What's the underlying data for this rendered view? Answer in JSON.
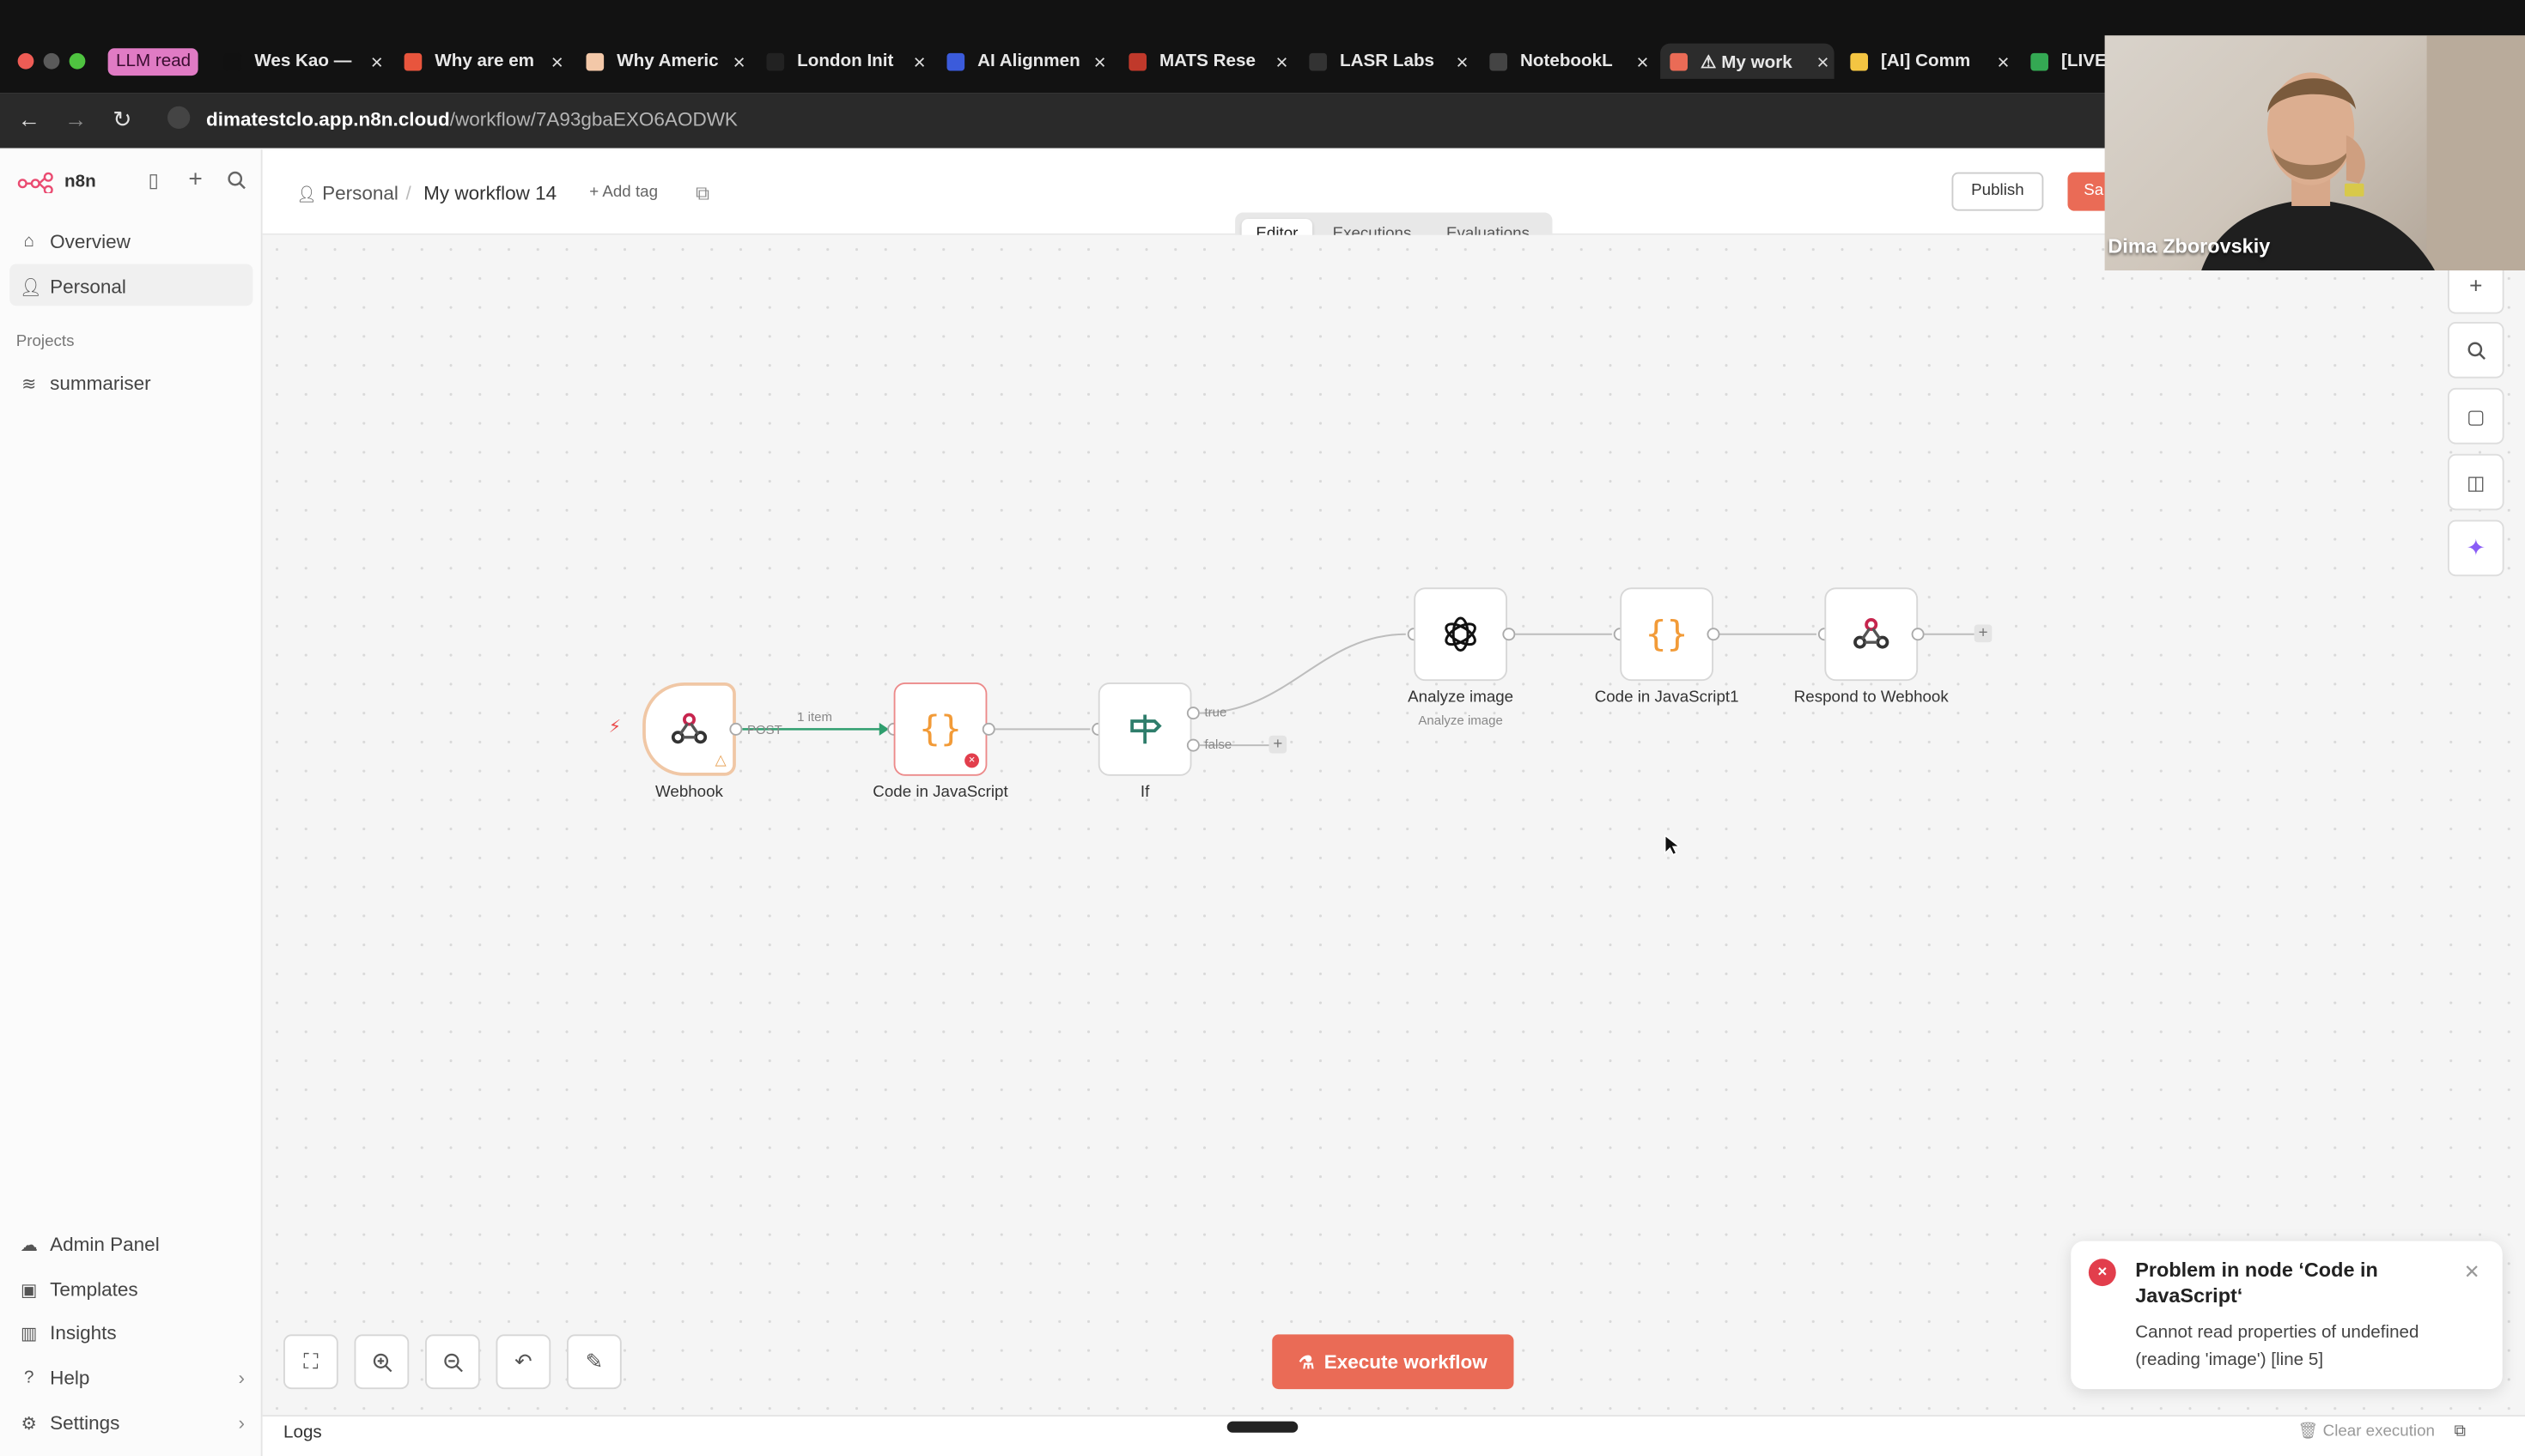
{
  "browser": {
    "tab_group": "LLM read",
    "tabs": [
      {
        "title": "Wes Kao —",
        "favicon_color": "#111111"
      },
      {
        "title": "Why are em",
        "favicon_color": "#e8553d"
      },
      {
        "title": "Why Americ",
        "favicon_color": "#f3c8a8"
      },
      {
        "title": "London Init",
        "favicon_color": "#222222"
      },
      {
        "title": "AI Alignmen",
        "favicon_color": "#3b5bdb"
      },
      {
        "title": "MATS Rese",
        "favicon_color": "#c0392b"
      },
      {
        "title": "LASR Labs",
        "favicon_color": "#333333"
      },
      {
        "title": "NotebookL",
        "favicon_color": "#444444"
      },
      {
        "title": "⚠ My work",
        "favicon_color": "#ea6b56",
        "active": true
      },
      {
        "title": "[AI] Comm",
        "favicon_color": "#f4c542"
      },
      {
        "title": "[LIVE]",
        "favicon_color": "#34a853"
      }
    ],
    "url_host": "dimatestclo.app.n8n.cloud",
    "url_path": "/workflow/7A93gbaEXO6AODWK"
  },
  "sidebar": {
    "logo": "n8n",
    "items": [
      {
        "label": "Overview",
        "icon": "home-icon"
      },
      {
        "label": "Personal",
        "icon": "user-icon"
      }
    ],
    "projects_heading": "Projects",
    "projects": [
      {
        "label": "summariser",
        "icon": "layers-icon"
      }
    ],
    "bottom": [
      {
        "label": "Admin Panel",
        "icon": "cloud-icon"
      },
      {
        "label": "Templates",
        "icon": "box-icon"
      },
      {
        "label": "Insights",
        "icon": "chart-icon"
      },
      {
        "label": "Help",
        "icon": "help-icon"
      },
      {
        "label": "Settings",
        "icon": "gear-icon"
      }
    ]
  },
  "header": {
    "crumb_project": "Personal",
    "separator": "/",
    "workflow_name": "My workflow 14",
    "add_tag": "+ Add tag",
    "tabs": [
      "Editor",
      "Executions",
      "Evaluations"
    ],
    "publish": "Publish",
    "save": "Sa"
  },
  "workflow": {
    "nodes": [
      {
        "name": "Webhook",
        "icon": "webhook-icon"
      },
      {
        "name": "Code in JavaScript",
        "icon": "code-braces-icon",
        "error": true
      },
      {
        "name": "If",
        "icon": "signpost-icon"
      },
      {
        "name": "Analyze image",
        "subtitle": "Analyze image",
        "icon": "openai-icon"
      },
      {
        "name": "Code in JavaScript1",
        "icon": "code-braces-icon"
      },
      {
        "name": "Respond to Webhook",
        "icon": "webhook-icon"
      }
    ],
    "edge_labels": {
      "post": "POST",
      "items": "1 item",
      "true": "true",
      "false": "false"
    }
  },
  "controls": {
    "execute": "Execute workflow",
    "logs": "Logs",
    "clear": "Clear execution"
  },
  "toast": {
    "title": "Problem in node ‘Code in JavaScript‘",
    "message": "Cannot read properties of undefined (reading 'image') [line 5]"
  },
  "webcam": {
    "name": "Dima Zborovskiy"
  },
  "colors": {
    "accent": "#ea6b56",
    "error": "#e23e4c",
    "edge_active": "#2f9e6e"
  }
}
